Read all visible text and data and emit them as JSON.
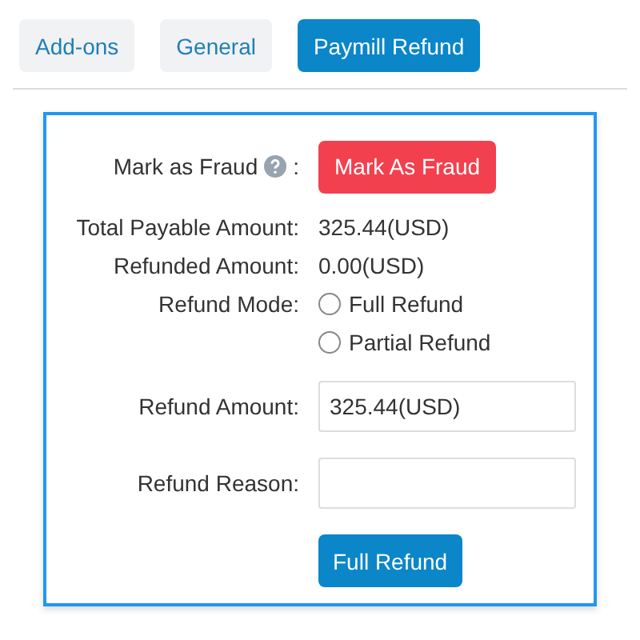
{
  "tabs": [
    {
      "label": "Add-ons",
      "selected": false
    },
    {
      "label": "General",
      "selected": false
    },
    {
      "label": "Paymill Refund",
      "selected": true
    }
  ],
  "form": {
    "fraud": {
      "label": "Mark as Fraud",
      "colon": ":",
      "button": "Mark As Fraud"
    },
    "rows": [
      {
        "label": "Total Payable Amount:",
        "value": "325.44(USD)"
      },
      {
        "label": "Refunded Amount:",
        "value": "0.00(USD)"
      }
    ],
    "refund_mode": {
      "label": "Refund Mode:",
      "options": [
        {
          "label": "Full Refund",
          "selected": false
        },
        {
          "label": "Partial Refund",
          "selected": false
        }
      ]
    },
    "refund_amount": {
      "label": "Refund Amount:",
      "value": "325.44(USD)"
    },
    "refund_reason": {
      "label": "Refund Reason:"
    },
    "submit": "Full Refund"
  }
}
